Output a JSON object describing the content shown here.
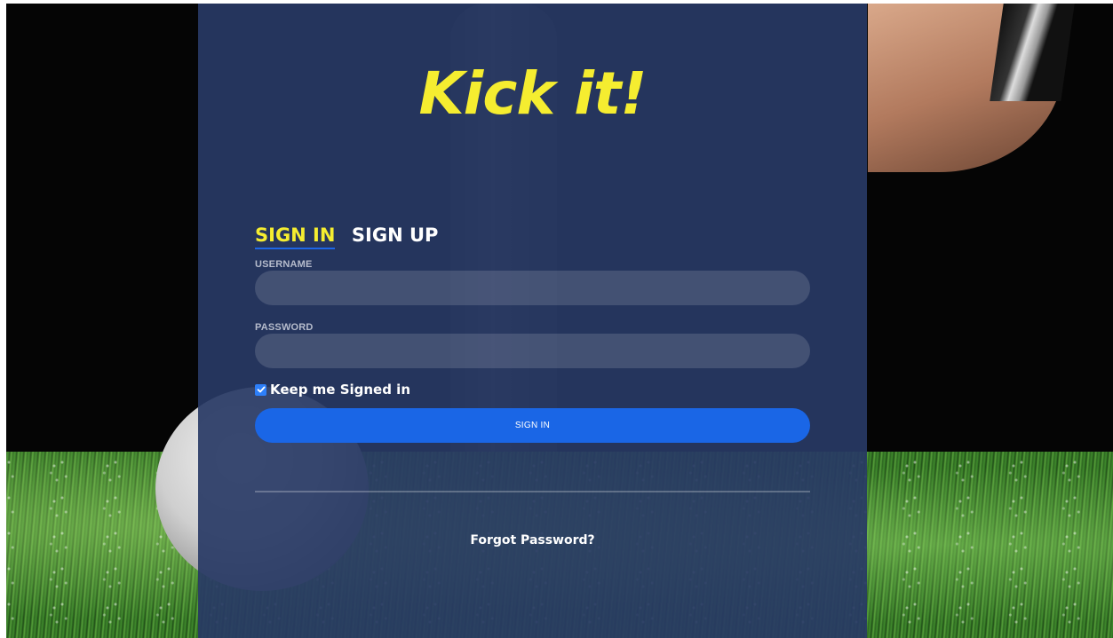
{
  "brand": {
    "logo_text": "Kick it!",
    "logo_color": "#f5ed30"
  },
  "tabs": [
    {
      "label": "SIGN IN",
      "active": true
    },
    {
      "label": "SIGN UP",
      "active": false
    }
  ],
  "form": {
    "username_label": "USERNAME",
    "username_value": "",
    "password_label": "PASSWORD",
    "password_value": "",
    "keep_signed_in_label": "Keep me Signed in",
    "keep_signed_in_checked": true,
    "submit_label": "SIGN IN",
    "forgot_password_label": "Forgot Password?"
  },
  "colors": {
    "panel": "#283965",
    "accent_blue": "#1a66e6",
    "tab_active": "#f5ed30"
  },
  "icons": {
    "checkbox": "checkmark-icon"
  }
}
